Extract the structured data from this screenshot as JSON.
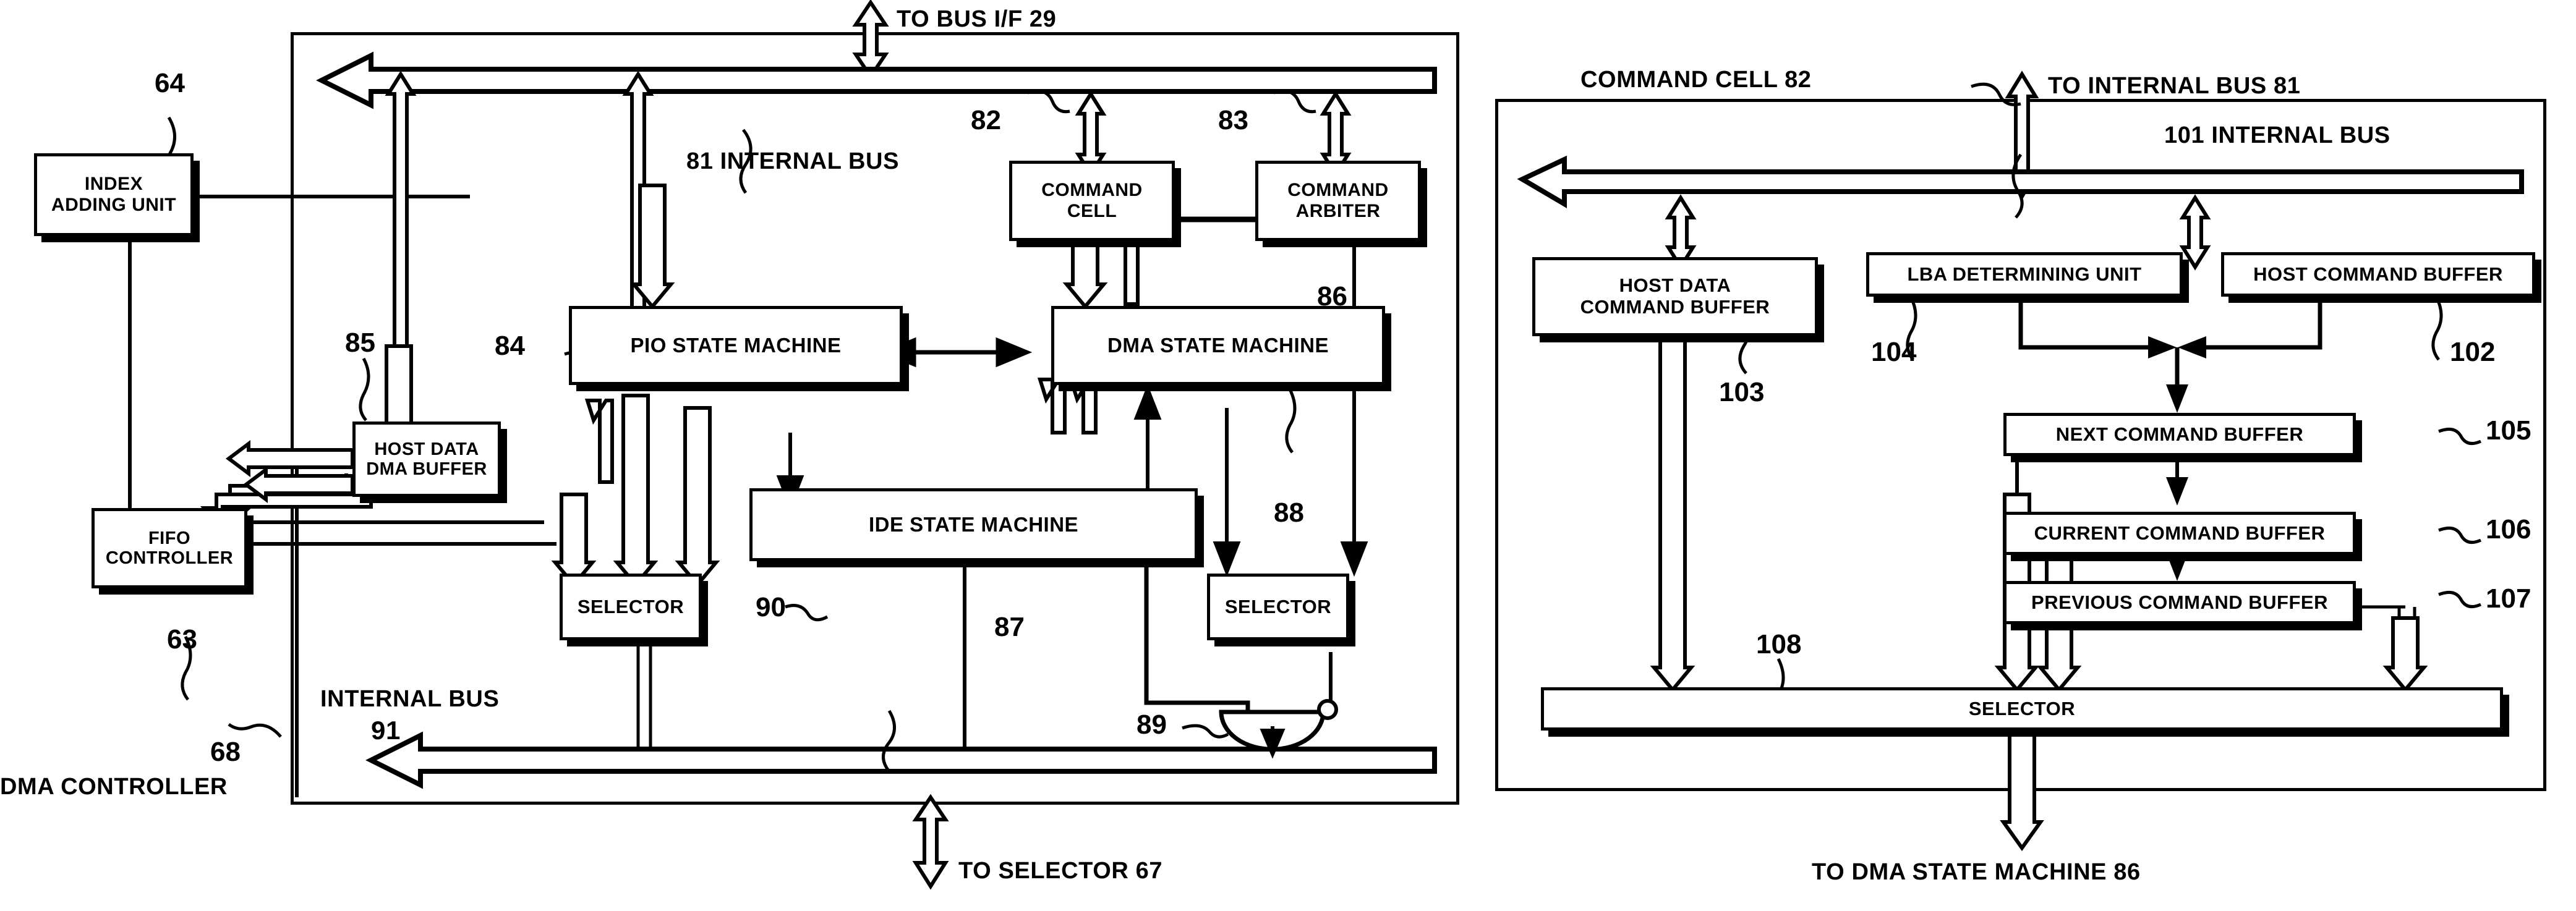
{
  "figure": {
    "left_panel": {
      "outer_label": "DMA CONTROLLER",
      "outer_ref": "68",
      "top_io_label": "TO BUS I/F  29",
      "bottom_io_label": "TO SELECTOR 67",
      "bus_top_label": "81 INTERNAL BUS",
      "bus_bottom_label_line1": "INTERNAL BUS",
      "bus_bottom_label_line2": "91",
      "blocks": [
        {
          "id": "index_adding_unit",
          "ref": "64",
          "line1": "INDEX",
          "line2": "ADDING UNIT"
        },
        {
          "id": "host_data_dma_buffer",
          "ref": "85",
          "line1": "HOST DATA",
          "line2": "DMA BUFFER"
        },
        {
          "id": "fifo_controller",
          "ref": "63",
          "line1": "FIFO",
          "line2": "CONTROLLER"
        },
        {
          "id": "command_cell",
          "ref": "82",
          "line1": "COMMAND",
          "line2": "CELL"
        },
        {
          "id": "command_arbiter",
          "ref": "83",
          "line1": "COMMAND",
          "line2": "ARBITER"
        },
        {
          "id": "pio_state_machine",
          "ref": "84",
          "line1": "PIO STATE MACHINE",
          "line2": ""
        },
        {
          "id": "dma_state_machine",
          "ref": "86",
          "line1": "DMA STATE MACHINE",
          "line2": ""
        },
        {
          "id": "ide_state_machine",
          "ref": "87",
          "line1": "IDE STATE MACHINE",
          "line2": ""
        },
        {
          "id": "selector_90",
          "ref": "90",
          "line1": "SELECTOR",
          "line2": ""
        },
        {
          "id": "selector_88",
          "ref": "88",
          "line1": "SELECTOR",
          "line2": ""
        },
        {
          "id": "and_gate_89",
          "ref": "89",
          "line1": "",
          "line2": ""
        }
      ]
    },
    "right_panel": {
      "outer_label": "COMMAND CELL 82",
      "top_io_label": "TO INTERNAL BUS 81",
      "bus_label": "101 INTERNAL BUS",
      "bottom_io_label": "TO DMA STATE MACHINE 86",
      "blocks": [
        {
          "id": "host_data_command_buffer",
          "ref": "103",
          "line1": "HOST DATA",
          "line2": "COMMAND BUFFER"
        },
        {
          "id": "lba_determining_unit",
          "ref": "104",
          "line1": "LBA DETERMINING UNIT",
          "line2": ""
        },
        {
          "id": "host_command_buffer",
          "ref": "102",
          "line1": "HOST COMMAND BUFFER",
          "line2": ""
        },
        {
          "id": "next_command_buffer",
          "ref": "105",
          "line1": "NEXT COMMAND BUFFER",
          "line2": ""
        },
        {
          "id": "current_command_buffer",
          "ref": "106",
          "line1": "CURRENT COMMAND BUFFER",
          "line2": ""
        },
        {
          "id": "previous_command_buffer",
          "ref": "107",
          "line1": "PREVIOUS COMMAND BUFFER",
          "line2": ""
        },
        {
          "id": "selector_108",
          "ref": "108",
          "line1": "SELECTOR",
          "line2": ""
        }
      ]
    },
    "colors": {
      "ink": "#000000",
      "paper": "#ffffff"
    }
  }
}
